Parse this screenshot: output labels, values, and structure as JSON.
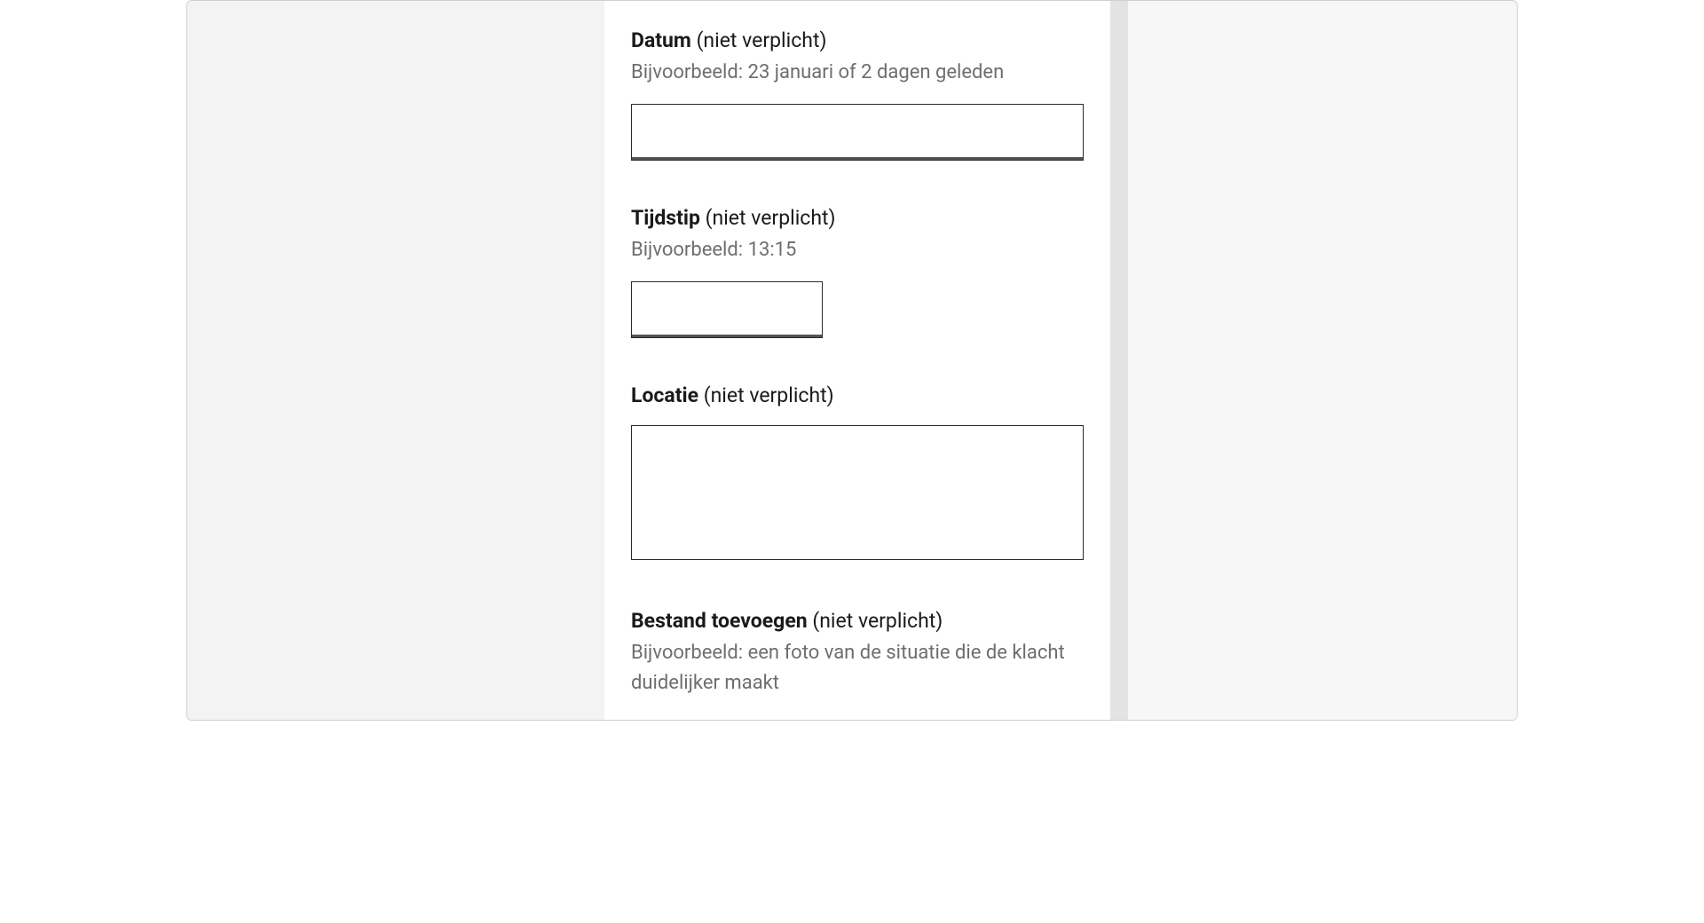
{
  "form": {
    "optional_suffix": "(niet verplicht)",
    "date": {
      "label": "Datum",
      "hint": "Bijvoorbeeld: 23 januari of 2 dagen geleden",
      "value": ""
    },
    "time": {
      "label": "Tijdstip",
      "hint": "Bijvoorbeeld: 13:15",
      "value": ""
    },
    "location": {
      "label": "Locatie",
      "value": ""
    },
    "attachment": {
      "label": "Bestand toevoegen",
      "hint": "Bijvoorbeeld: een foto van de situatie die de klacht duidelijker maakt"
    }
  }
}
